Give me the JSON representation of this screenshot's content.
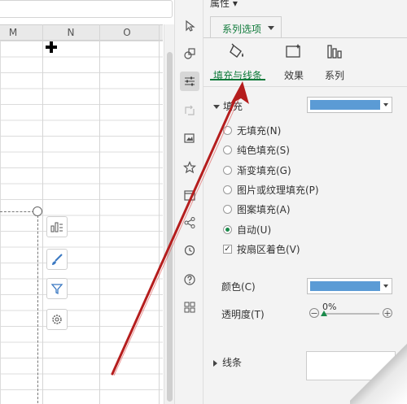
{
  "sheet": {
    "columns": [
      "M",
      "N",
      "O"
    ]
  },
  "panel": {
    "title": "属性 ▾",
    "series_tab": "系列选项",
    "subtabs": [
      {
        "label": "填充与线条",
        "icon": "fill-bucket-icon",
        "active": true
      },
      {
        "label": "效果",
        "icon": "effects-icon",
        "active": false
      },
      {
        "label": "系列",
        "icon": "series-bars-icon",
        "active": false
      }
    ],
    "fill": {
      "heading": "填充",
      "color": "#5b9bd5",
      "options": [
        {
          "label": "无填充(N)",
          "type": "radio",
          "checked": false
        },
        {
          "label": "纯色填充(S)",
          "type": "radio",
          "checked": false
        },
        {
          "label": "渐变填充(G)",
          "type": "radio",
          "checked": false
        },
        {
          "label": "图片或纹理填充(P)",
          "type": "radio",
          "checked": false
        },
        {
          "label": "图案填充(A)",
          "type": "radio",
          "checked": false
        },
        {
          "label": "自动(U)",
          "type": "radio",
          "checked": true
        },
        {
          "label": "按扇区着色(V)",
          "type": "checkbox",
          "checked": true
        }
      ]
    },
    "color_label": "颜色(C)",
    "color_value": "#5b9bd5",
    "transparency_label": "透明度(T)",
    "transparency_value": "0%",
    "line_heading": "线条"
  },
  "colors": {
    "accent_green": "#0f7a3a",
    "arrow_red": "#b51d1d"
  }
}
